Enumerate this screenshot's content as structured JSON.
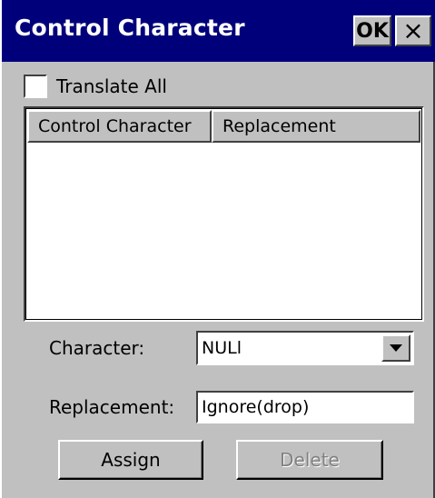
{
  "window": {
    "title": "Control Character",
    "ok_label": "OK",
    "close_label": "×"
  },
  "options": {
    "translate_all_label": "Translate All",
    "translate_all_checked": false
  },
  "list": {
    "columns": [
      "Control Character",
      "Replacement"
    ],
    "rows": []
  },
  "form": {
    "character_label": "Character:",
    "character_value": "NULl",
    "replacement_label": "Replacement:",
    "replacement_value": "Ignore(drop)"
  },
  "buttons": {
    "assign_label": "Assign",
    "delete_label": "Delete",
    "delete_enabled": false
  },
  "icons": {
    "close": "close-icon",
    "dropdown": "triangle-down-icon"
  }
}
